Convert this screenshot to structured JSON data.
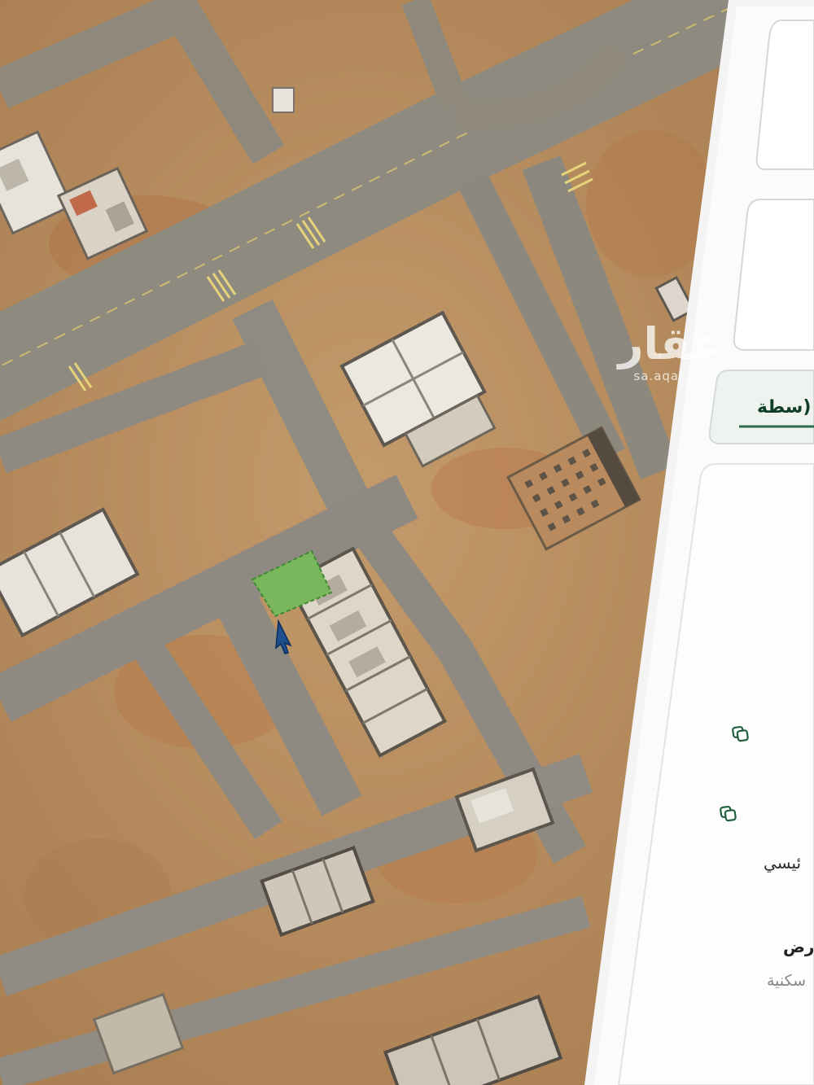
{
  "watermark": {
    "logo": "عقار",
    "url": "sa.aqar.fm"
  },
  "panel": {
    "section_label_partial": "(سطة",
    "copy_icons": [
      "copy-icon",
      "copy-icon"
    ],
    "text_fragments": [
      "ئيسي",
      "رض",
      "سكنية"
    ]
  },
  "map": {
    "highlighted_plot_color": "#79b65c",
    "highlighted_plot_border": "#3f8a32",
    "cursor_color": "#1f4f8f"
  }
}
